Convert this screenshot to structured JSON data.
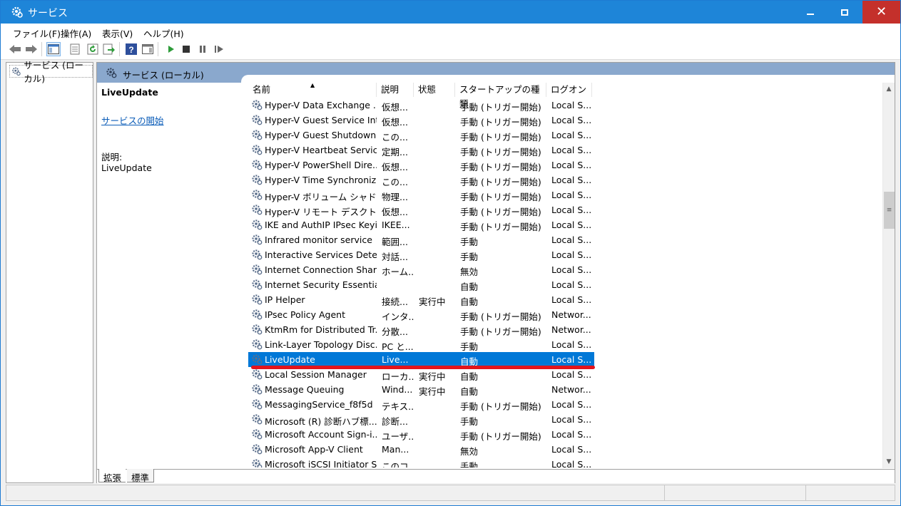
{
  "window": {
    "title": "サービス",
    "buttons": {
      "minimize": "minimize-icon",
      "maximize": "maximize-icon",
      "close": "close-icon"
    }
  },
  "menu": [
    "ファイル(F)",
    "操作(A)",
    "表示(V)",
    "ヘルプ(H)"
  ],
  "toolbar_icons": [
    "back-arrow-icon",
    "forward-arrow-icon",
    "console-tree-icon",
    "properties-icon",
    "refresh-icon",
    "export-icon",
    "help-icon",
    "show-hide-icon",
    "start-service-icon",
    "stop-service-icon",
    "pause-service-icon",
    "resume-service-icon"
  ],
  "tree": {
    "item_label": "サービス (ローカル)"
  },
  "panel": {
    "header_title": "サービス (ローカル)",
    "selected_service_title": "LiveUpdate",
    "start_link": "サービスの開始",
    "description_label": "説明:",
    "description_text": "LiveUpdate"
  },
  "columns": {
    "name": "名前",
    "description": "説明",
    "status": "状態",
    "startup_type": "スタートアップの種類",
    "logon": "ログオン"
  },
  "services": [
    [
      "Hyper-V Data Exchange ...",
      "仮想...",
      "",
      "手動 (トリガー開始)",
      "Local S..."
    ],
    [
      "Hyper-V Guest Service Int...",
      "仮想...",
      "",
      "手動 (トリガー開始)",
      "Local S..."
    ],
    [
      "Hyper-V Guest Shutdown...",
      "この...",
      "",
      "手動 (トリガー開始)",
      "Local S..."
    ],
    [
      "Hyper-V Heartbeat Service",
      "定期...",
      "",
      "手動 (トリガー開始)",
      "Local S..."
    ],
    [
      "Hyper-V PowerShell Dire...",
      "仮想...",
      "",
      "手動 (トリガー開始)",
      "Local S..."
    ],
    [
      "Hyper-V Time Synchroniz...",
      "この...",
      "",
      "手動 (トリガー開始)",
      "Local S..."
    ],
    [
      "Hyper-V ボリューム シャドウ ...",
      "物理...",
      "",
      "手動 (トリガー開始)",
      "Local S..."
    ],
    [
      "Hyper-V リモート デスクトッ...",
      "仮想...",
      "",
      "手動 (トリガー開始)",
      "Local S..."
    ],
    [
      "IKE and AuthIP IPsec Keyi...",
      "IKEE...",
      "",
      "手動 (トリガー開始)",
      "Local S..."
    ],
    [
      "Infrared monitor service",
      "範囲...",
      "",
      "手動",
      "Local S..."
    ],
    [
      "Interactive Services Detec...",
      "対話...",
      "",
      "手動",
      "Local S..."
    ],
    [
      "Internet Connection Shari...",
      "ホーム...",
      "",
      "無効",
      "Local S..."
    ],
    [
      "Internet Security Essential...",
      "",
      "",
      "自動",
      "Local S..."
    ],
    [
      "IP Helper",
      "接続...",
      "実行中",
      "自動",
      "Local S..."
    ],
    [
      "IPsec Policy Agent",
      "インタ...",
      "",
      "手動 (トリガー開始)",
      "Networ..."
    ],
    [
      "KtmRm for Distributed Tr...",
      "分散...",
      "",
      "手動 (トリガー開始)",
      "Networ..."
    ],
    [
      "Link-Layer Topology Disc...",
      "PC と...",
      "",
      "手動",
      "Local S..."
    ],
    [
      "LiveUpdate",
      "Live...",
      "",
      "自動",
      "Local S..."
    ],
    [
      "Local Session Manager",
      "ローカ...",
      "実行中",
      "自動",
      "Local S..."
    ],
    [
      "Message Queuing",
      "Wind...",
      "実行中",
      "自動",
      "Networ..."
    ],
    [
      "MessagingService_f8f5d",
      "テキス...",
      "",
      "手動 (トリガー開始)",
      "Local S..."
    ],
    [
      "Microsoft (R) 診断ハブ標...",
      "診断...",
      "",
      "手動",
      "Local S..."
    ],
    [
      "Microsoft Account Sign-i...",
      "ユーザ...",
      "",
      "手動 (トリガー開始)",
      "Local S..."
    ],
    [
      "Microsoft App-V Client",
      "Man...",
      "",
      "無効",
      "Local S..."
    ],
    [
      "Microsoft iSCSI Initiator S...",
      "このコ...",
      "",
      "手動",
      "Local S..."
    ]
  ],
  "selected_index": 17,
  "tabs": {
    "extended": "拡張",
    "standard": "標準"
  },
  "colors": {
    "title_bar": "#1e85d8",
    "selection": "#0078d7",
    "header": "#8aa8cd",
    "annotation": "#e3141c"
  }
}
